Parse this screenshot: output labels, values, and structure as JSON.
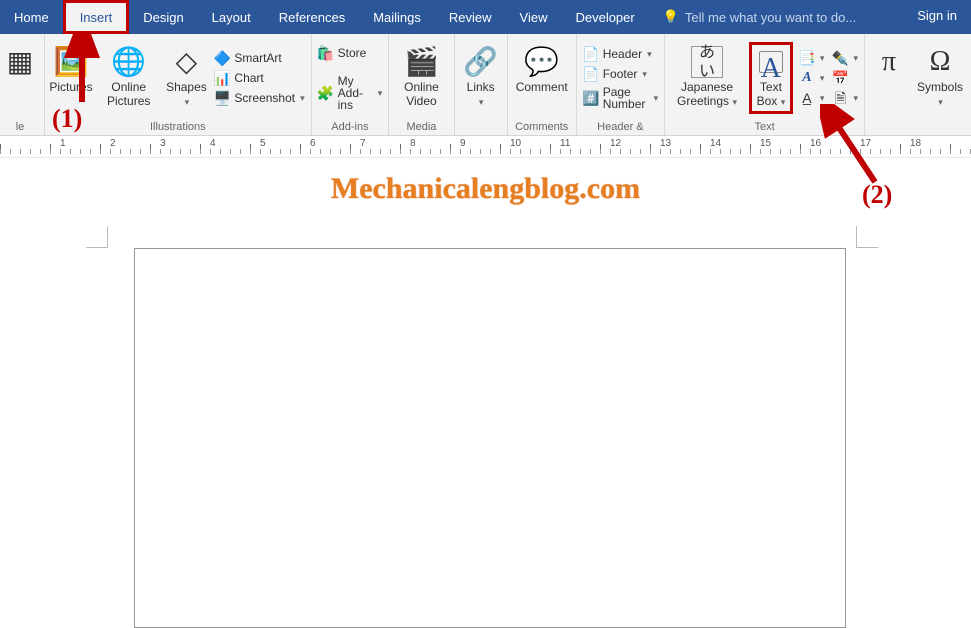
{
  "tabs": {
    "home": "Home",
    "insert": "Insert",
    "design": "Design",
    "layout": "Layout",
    "references": "References",
    "mailings": "Mailings",
    "review": "Review",
    "view": "View",
    "developer": "Developer",
    "search_placeholder": "Tell me what you want to do...",
    "signin": "Sign in"
  },
  "groups": {
    "tables": "le",
    "illustrations": "Illustrations",
    "addins": "Add-ins",
    "media": "Media",
    "links": "",
    "comments": "Comments",
    "headerfooter": "Header & Footer",
    "text": "Text",
    "symbols": ""
  },
  "buttons": {
    "pictures": "Pictures",
    "online_pictures": "Online Pictures",
    "shapes": "Shapes",
    "smartart": "SmartArt",
    "chart": "Chart",
    "screenshot": "Screenshot",
    "store": "Store",
    "myaddins": "My Add-ins",
    "online_video": "Online Video",
    "links_btn": "Links",
    "comment": "Comment",
    "header": "Header",
    "footer": "Footer",
    "page_number": "Page Number",
    "japanese_greetings": "Japanese Greetings",
    "text_box": "Text Box",
    "symbols": "Symbols"
  },
  "ruler_numbers": [
    "1",
    "2",
    "3",
    "4",
    "5",
    "6",
    "7",
    "8",
    "9",
    "10",
    "11",
    "12",
    "13",
    "14",
    "15",
    "16",
    "17",
    "18"
  ],
  "watermark": "Mechanicalengblog.com",
  "annotations": {
    "one": "(1)",
    "two": "(2)"
  }
}
